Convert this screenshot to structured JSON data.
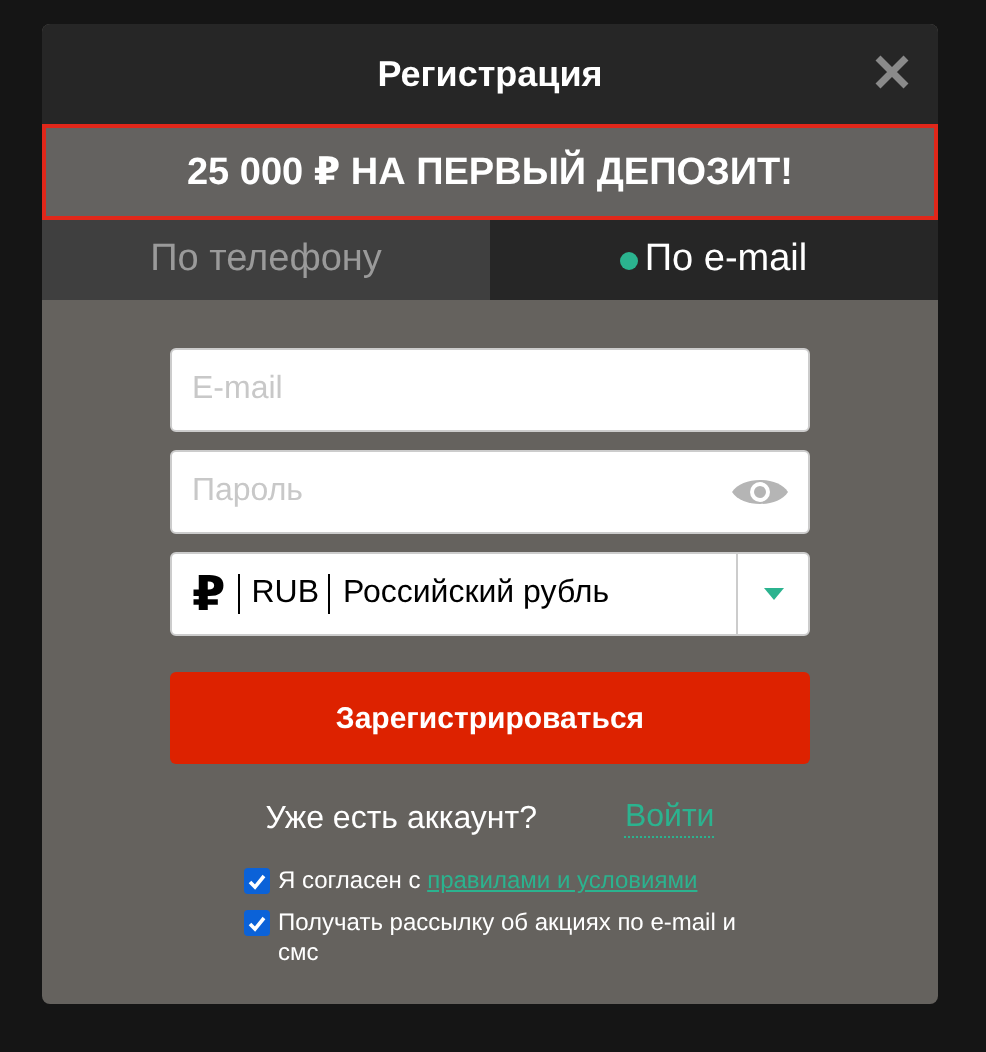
{
  "dialog": {
    "title": "Регистрация",
    "banner": "25 000 ₽ НА ПЕРВЫЙ ДЕПОЗИТ!",
    "tabs": [
      {
        "label": "По телефону",
        "selected": false
      },
      {
        "label": "По e-mail",
        "selected": true
      }
    ],
    "fields": [
      {
        "kind": "text",
        "placeholder": "E-mail"
      },
      {
        "kind": "password",
        "placeholder": "Пароль"
      }
    ],
    "currency": {
      "symbol": "₽",
      "code": "RUB",
      "name": "Российский рубль"
    },
    "submit": "Зарегистрироваться",
    "login_prompt": "Уже есть аккаунт?",
    "login_link": "Войти",
    "checkboxes": [
      {
        "label": "Я согласен с",
        "link": "правилами и условиями",
        "checked": true
      },
      {
        "label": "Получать рассылку об акциях по e-mail и смс",
        "checked": true
      }
    ]
  }
}
